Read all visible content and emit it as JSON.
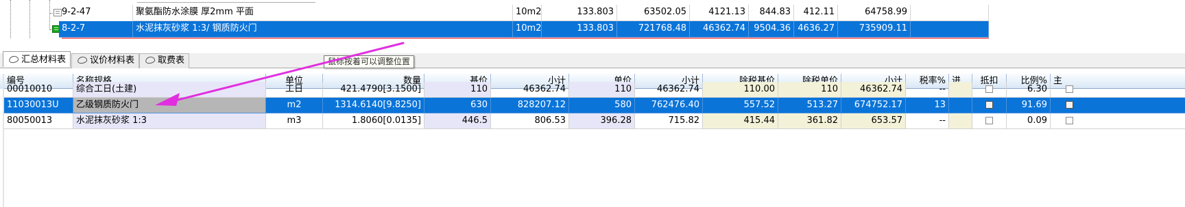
{
  "quota_rows": [
    {
      "code": "9-2-47",
      "name": "聚氨酯防水涂膜 厚2mm 平面",
      "unit": "10m2",
      "qty": "133.803",
      "total": "63502.05",
      "labor": "4121.13",
      "material": "844.83",
      "machine": "412.11",
      "sum": "64758.99",
      "selected": false
    },
    {
      "code": "8-2-7",
      "name": "水泥抹灰砂浆 1:3/ 钢质防火门",
      "unit": "10m2",
      "qty": "133.803",
      "total": "721768.48",
      "labor": "46362.74",
      "material": "9504.36",
      "machine": "4636.27",
      "sum": "735909.11",
      "selected": true
    }
  ],
  "tabs": [
    {
      "label": "汇总材料表",
      "active": true
    },
    {
      "label": "议价材料表",
      "active": false
    },
    {
      "label": "取费表",
      "active": false
    }
  ],
  "tooltip": "鼠标按着可以调整位置",
  "columns": [
    "编号",
    "名称规格",
    "单位",
    "数量",
    "基价",
    "小计",
    "单价",
    "小计",
    "除税基价",
    "除税单价",
    "小计",
    "税率%",
    "进..",
    "抵扣",
    "比例%",
    "主"
  ],
  "materials": [
    {
      "code": "00010010",
      "name": "综合工日(土建)",
      "unit": "工日",
      "qty": "421.4790[3.1500]",
      "base": "110",
      "subtotal1": "46362.74",
      "price": "110",
      "subtotal2": "46362.74",
      "tax_base": "110.00",
      "tax_price": "110",
      "subtotal3": "46362.74",
      "tax_rate": "--",
      "ratio": "6.30",
      "selected": false
    },
    {
      "code": "11030013U",
      "name": "乙级钢质防火门",
      "unit": "m2",
      "qty": "1314.6140[9.8250]",
      "base": "630",
      "subtotal1": "828207.12",
      "price": "580",
      "subtotal2": "762476.40",
      "tax_base": "557.52",
      "tax_price": "513.27",
      "subtotal3": "674752.17",
      "tax_rate": "13",
      "ratio": "91.69",
      "selected": true
    },
    {
      "code": "80050013",
      "name": "水泥抹灰砂浆 1:3",
      "unit": "m3",
      "qty": "1.8060[0.0135]",
      "base": "446.5",
      "subtotal1": "806.53",
      "price": "396.28",
      "subtotal2": "715.82",
      "tax_base": "415.44",
      "tax_price": "361.82",
      "subtotal3": "653.57",
      "tax_rate": "--",
      "ratio": "0.09",
      "selected": false
    }
  ],
  "colors": {
    "selection": "#0a74d9",
    "annotation_arrow": "#e22de0",
    "header_gradient_end": "#d8e6f6",
    "lavender_col": "#e7e6f8",
    "yellow_col": "#f3f2d9"
  },
  "icons": {
    "tree_node": "tree-node-icon",
    "tree_node_selected": "green-node-icon",
    "tab": "link-tab-icon",
    "checkbox": "checkbox-icon"
  }
}
